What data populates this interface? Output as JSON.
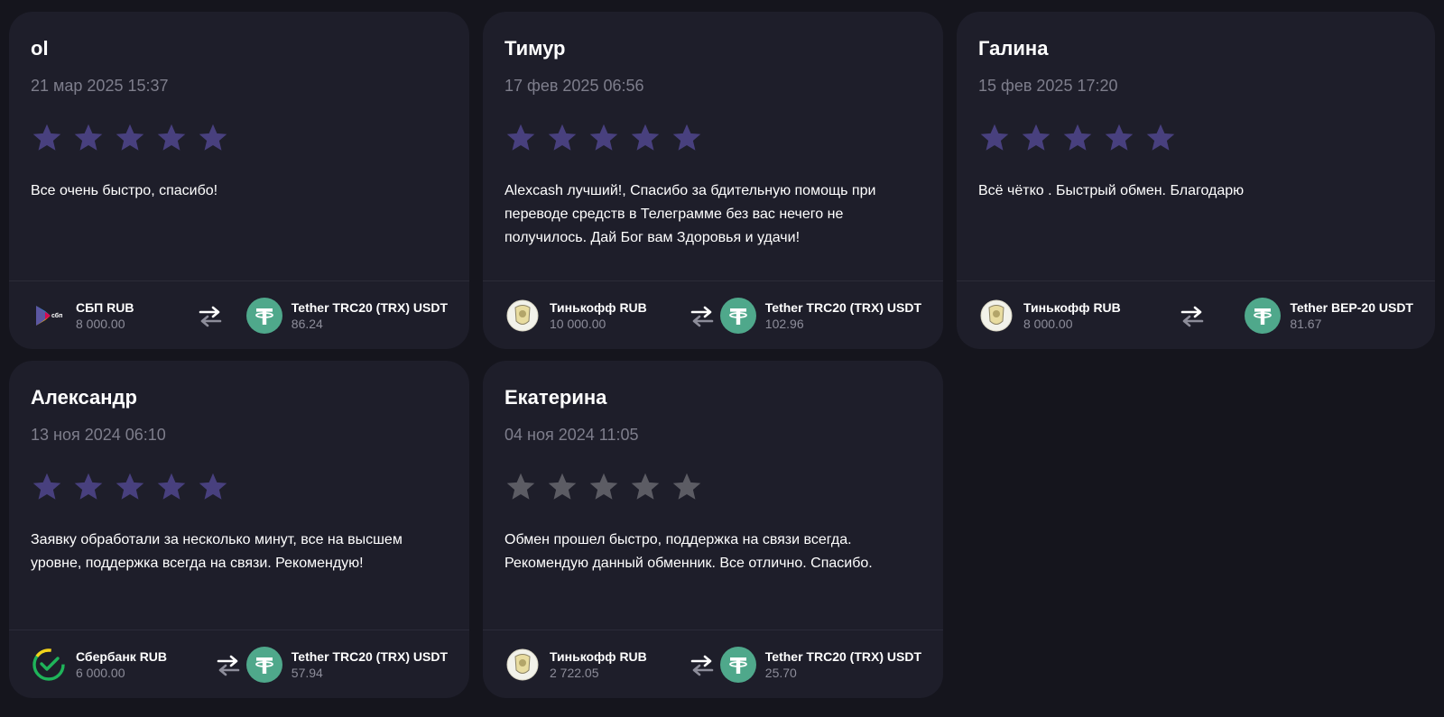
{
  "colors": {
    "star_active": "#48407e",
    "star_inactive": "#5c5c64",
    "tether": "#4fa88b"
  },
  "reviews": [
    {
      "name": "ol",
      "date": "21 мар 2025 15:37",
      "rating": 5,
      "text": "Все очень быстро, спасибо!",
      "from": {
        "icon": "sbp-icon",
        "name": "СБП RUB",
        "amount": "8 000.00"
      },
      "to": {
        "icon": "tether-icon",
        "name": "Tether TRC20 (TRX) USDT",
        "amount": "86.24"
      }
    },
    {
      "name": "Тимур",
      "date": "17 фев 2025 06:56",
      "rating": 5,
      "text": "Alexcash лучший!, Спасибо за бдительную помощь при переводе средств в Телеграмме без вас нечего не получилось. Дай Бог вам Здоровья и удачи!",
      "from": {
        "icon": "tinkoff-icon",
        "name": "Тинькофф RUB",
        "amount": "10 000.00"
      },
      "to": {
        "icon": "tether-icon",
        "name": "Tether TRC20 (TRX) USDT",
        "amount": "102.96"
      }
    },
    {
      "name": "Галина",
      "date": "15 фев 2025 17:20",
      "rating": 5,
      "text": "Всё чётко . Быстрый обмен. Благодарю",
      "from": {
        "icon": "tinkoff-icon",
        "name": "Тинькофф RUB",
        "amount": "8 000.00"
      },
      "to": {
        "icon": "tether-icon",
        "name": "Tether BEP-20 USDT",
        "amount": "81.67"
      }
    },
    {
      "name": "Александр",
      "date": "13 ноя 2024 06:10",
      "rating": 5,
      "text": "Заявку обработали за несколько минут, все на высшем уровне, поддержка всегда на связи. Рекомендую!",
      "from": {
        "icon": "sberbank-icon",
        "name": "Сбербанк RUB",
        "amount": "6 000.00"
      },
      "to": {
        "icon": "tether-icon",
        "name": "Tether TRC20 (TRX) USDT",
        "amount": "57.94"
      }
    },
    {
      "name": "Екатерина",
      "date": "04 ноя 2024 11:05",
      "rating": 0,
      "text": "Обмен прошел быстро, поддержка на связи всегда. Рекомендую данный обменник. Все отлично. Спасибо.",
      "from": {
        "icon": "tinkoff-icon",
        "name": "Тинькофф RUB",
        "amount": "2 722.05"
      },
      "to": {
        "icon": "tether-icon",
        "name": "Tether TRC20 (TRX) USDT",
        "amount": "25.70"
      }
    }
  ]
}
